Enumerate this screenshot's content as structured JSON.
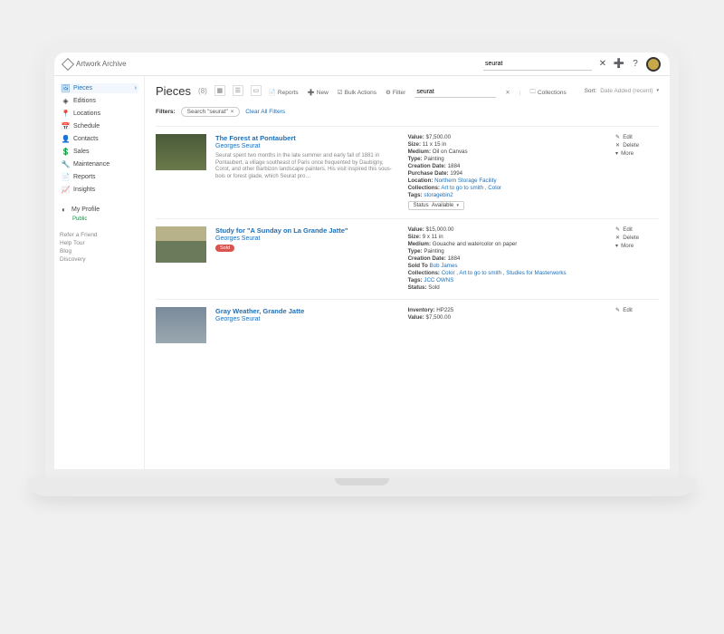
{
  "brand": "Artwork Archive",
  "topSearch": {
    "value": "seurat"
  },
  "sidebar": {
    "items": [
      {
        "icon": "🖼",
        "label": "Pieces",
        "active": true
      },
      {
        "icon": "◈",
        "label": "Editions"
      },
      {
        "icon": "📍",
        "label": "Locations"
      },
      {
        "icon": "📅",
        "label": "Schedule"
      },
      {
        "icon": "👤",
        "label": "Contacts"
      },
      {
        "icon": "💲",
        "label": "Sales"
      },
      {
        "icon": "🔧",
        "label": "Maintenance"
      },
      {
        "icon": "📄",
        "label": "Reports"
      },
      {
        "icon": "📈",
        "label": "Insights"
      }
    ],
    "profile": {
      "label": "My Profile",
      "status": "Public"
    },
    "footer": [
      "Refer a Friend",
      "Help Tour",
      "Blog",
      "Discovery"
    ]
  },
  "header": {
    "title": "Pieces",
    "count": "(8)",
    "searchValue": "seurat",
    "sortLabel": "Sort:",
    "sortValue": "Date Added (recent)"
  },
  "toolbar": {
    "reports": "Reports",
    "new": "New",
    "bulk": "Bulk Actions",
    "filter": "Filter",
    "collections": "Collections"
  },
  "filters": {
    "label": "Filters:",
    "chip": "Search \"seurat\"",
    "clear": "Clear All Filters"
  },
  "actions": {
    "edit": "Edit",
    "delete": "Delete",
    "more": "More"
  },
  "pieces": [
    {
      "title": "The Forest at Pontaubert",
      "artist": "Georges Seurat",
      "desc": "Seurat spent two months in the late summer and early fall of 1881 in Pontaubert, a village southeast of Paris once frequented by Daubigny, Corot, and other Barbizon landscape painters. His visit inspired this sous-bois or forest glade, which Seurat pro…",
      "meta": {
        "value": "$7,500.00",
        "size": "11 x 15 in",
        "medium": "Oil on Canvas",
        "type": "Painting",
        "creationDate": "1884",
        "purchaseDate": "1994",
        "location": "Northern Storage Facility",
        "collections": "Art to go to smith , Color",
        "tags": "storagebin2",
        "statusLabel": "Status",
        "statusValue": "Available"
      }
    },
    {
      "title": "Study for \"A Sunday on La Grande Jatte\"",
      "artist": "Georges Seurat",
      "soldBadge": "Sold",
      "meta": {
        "value": "$15,000.00",
        "size": "9 x 11 in",
        "medium": "Gouache and watercolor on paper",
        "type": "Painting",
        "creationDate": "1884",
        "soldTo": "Bob James",
        "collections": "Color , Art to go to smith , Studies for Masterworks",
        "tags": "JCC OWNS",
        "status": "Sold"
      }
    },
    {
      "title": "Gray Weather, Grande Jatte",
      "artist": "Georges Seurat",
      "meta": {
        "inventory": "HP225",
        "value": "$7,500.00"
      }
    }
  ],
  "labels": {
    "value": "Value:",
    "size": "Size:",
    "medium": "Medium:",
    "type": "Type:",
    "creationDate": "Creation Date:",
    "purchaseDate": "Purchase Date:",
    "location": "Location:",
    "collections": "Collections:",
    "tags": "Tags:",
    "status": "Status:",
    "soldTo": "Sold To",
    "inventory": "Inventory:"
  }
}
